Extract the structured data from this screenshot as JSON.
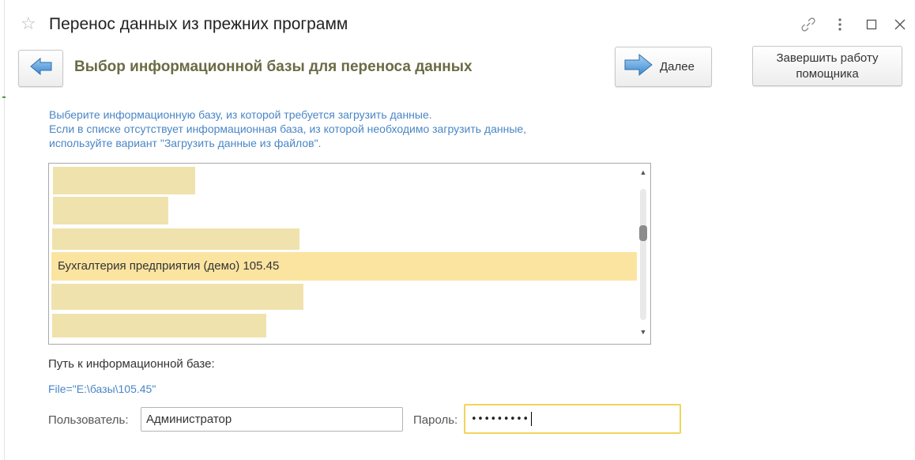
{
  "window": {
    "title": "Перенос данных из прежних программ",
    "icons": [
      "star-icon",
      "link-icon",
      "more-icon",
      "maximize-icon",
      "close-icon"
    ]
  },
  "toolbar": {
    "back_icon": "arrow-left-icon",
    "next_label": "Далее",
    "next_icon": "arrow-right-icon",
    "finish_line1": "Завершить работу",
    "finish_line2": "помощника"
  },
  "page_title": "Выбор информационной базы для переноса данных",
  "instructions": [
    "Выберите информационную базу, из которой требуется загрузить данные.",
    "Если в списке отсутствует информационная база, из которой необходимо загрузить данные,",
    "используйте вариант \"Загрузить данные из файлов\"."
  ],
  "database_list": {
    "selected_item": "Бухгалтерия предприятия (демо) 105.45",
    "redacted_count": 5
  },
  "path": {
    "label": "Путь к информационной базе:",
    "value": "File=\"E:\\базы\\105.45\""
  },
  "credentials": {
    "user_label": "Пользователь:",
    "user_value": "Администратор",
    "password_label": "Пароль:",
    "password_value": "•••••••••"
  },
  "colors": {
    "accent_blue": "#4a86c5",
    "title_olive": "#6b6b45",
    "selection": "#fbe4a0",
    "redaction": "#f0e2ad",
    "focus_border": "#f2d45c"
  }
}
